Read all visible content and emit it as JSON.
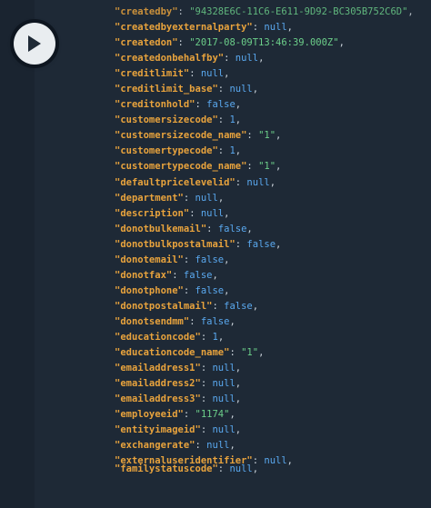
{
  "player": {
    "play_icon": "play-icon"
  },
  "code_lines": [
    {
      "key": "\"createdby\"",
      "sep": ": ",
      "value": "\"94328E6C-11C6-E611-9D92-BC305B752C6D\"",
      "vtype": "s",
      "comma": ","
    },
    {
      "key": "\"createdbyexternalparty\"",
      "sep": ": ",
      "value": "null",
      "vtype": "n",
      "comma": ","
    },
    {
      "key": "\"createdon\"",
      "sep": ": ",
      "value": "\"2017-08-09T13:46:39.000Z\"",
      "vtype": "s",
      "comma": ","
    },
    {
      "key": "\"createdonbehalfby\"",
      "sep": ": ",
      "value": "null",
      "vtype": "n",
      "comma": ","
    },
    {
      "key": "\"creditlimit\"",
      "sep": ": ",
      "value": "null",
      "vtype": "n",
      "comma": ","
    },
    {
      "key": "\"creditlimit_base\"",
      "sep": ": ",
      "value": "null",
      "vtype": "n",
      "comma": ","
    },
    {
      "key": "\"creditonhold\"",
      "sep": ": ",
      "value": "false",
      "vtype": "n",
      "comma": ","
    },
    {
      "key": "\"customersizecode\"",
      "sep": ": ",
      "value": "1",
      "vtype": "n",
      "comma": ","
    },
    {
      "key": "\"customersizecode_name\"",
      "sep": ": ",
      "value": "\"1\"",
      "vtype": "s",
      "comma": ","
    },
    {
      "key": "\"customertypecode\"",
      "sep": ": ",
      "value": "1",
      "vtype": "n",
      "comma": ","
    },
    {
      "key": "\"customertypecode_name\"",
      "sep": ": ",
      "value": "\"1\"",
      "vtype": "s",
      "comma": ","
    },
    {
      "key": "\"defaultpricelevelid\"",
      "sep": ": ",
      "value": "null",
      "vtype": "n",
      "comma": ","
    },
    {
      "key": "\"department\"",
      "sep": ": ",
      "value": "null",
      "vtype": "n",
      "comma": ","
    },
    {
      "key": "\"description\"",
      "sep": ": ",
      "value": "null",
      "vtype": "n",
      "comma": ","
    },
    {
      "key": "\"donotbulkemail\"",
      "sep": ": ",
      "value": "false",
      "vtype": "n",
      "comma": ","
    },
    {
      "key": "\"donotbulkpostalmail\"",
      "sep": ": ",
      "value": "false",
      "vtype": "n",
      "comma": ","
    },
    {
      "key": "\"donotemail\"",
      "sep": ": ",
      "value": "false",
      "vtype": "n",
      "comma": ","
    },
    {
      "key": "\"donotfax\"",
      "sep": ": ",
      "value": "false",
      "vtype": "n",
      "comma": ","
    },
    {
      "key": "\"donotphone\"",
      "sep": ": ",
      "value": "false",
      "vtype": "n",
      "comma": ","
    },
    {
      "key": "\"donotpostalmail\"",
      "sep": ": ",
      "value": "false",
      "vtype": "n",
      "comma": ","
    },
    {
      "key": "\"donotsendmm\"",
      "sep": ": ",
      "value": "false",
      "vtype": "n",
      "comma": ","
    },
    {
      "key": "\"educationcode\"",
      "sep": ": ",
      "value": "1",
      "vtype": "n",
      "comma": ","
    },
    {
      "key": "\"educationcode_name\"",
      "sep": ": ",
      "value": "\"1\"",
      "vtype": "s",
      "comma": ","
    },
    {
      "key": "\"emailaddress1\"",
      "sep": ": ",
      "value": "null",
      "vtype": "n",
      "comma": ","
    },
    {
      "key": "\"emailaddress2\"",
      "sep": ": ",
      "value": "null",
      "vtype": "n",
      "comma": ","
    },
    {
      "key": "\"emailaddress3\"",
      "sep": ": ",
      "value": "null",
      "vtype": "n",
      "comma": ","
    },
    {
      "key": "\"employeeid\"",
      "sep": ": ",
      "value": "\"1174\"",
      "vtype": "s",
      "comma": ","
    },
    {
      "key": "\"entityimageid\"",
      "sep": ": ",
      "value": "null",
      "vtype": "n",
      "comma": ","
    },
    {
      "key": "\"exchangerate\"",
      "sep": ": ",
      "value": "null",
      "vtype": "n",
      "comma": ","
    },
    {
      "key": "\"externaluseridentifier\"",
      "sep": ": ",
      "value": "null",
      "vtype": "n",
      "comma": ","
    },
    {
      "key": "\"familystatuscode\"",
      "sep": ": ",
      "value": "null",
      "vtype": "n",
      "comma": ","
    }
  ],
  "colors": {
    "background": "#1e2936",
    "key": "#e8a33d",
    "string": "#6ccf8a",
    "literal": "#5aa9f0",
    "punctuation": "#c9d1d9",
    "play_button": "#e9edf0"
  }
}
